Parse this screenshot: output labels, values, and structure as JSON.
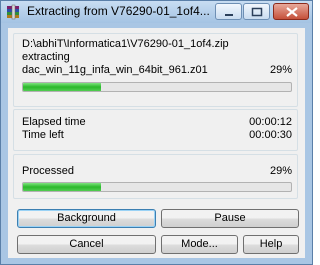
{
  "window": {
    "title": "Extracting from V76290-01_1of4....",
    "icons": {
      "app": "archive-app-icon",
      "minimize": "minimize-icon",
      "maximize": "maximize-icon",
      "close": "close-icon"
    }
  },
  "archive": {
    "path": "D:\\abhiT\\Informatica1\\V76290-01_1of4.zip",
    "action": "extracting",
    "current_file": "dac_win_11g_infa_win_64bit_961.z01",
    "file_percent_text": "29%",
    "file_progress": 0.29
  },
  "timing": {
    "elapsed_label": "Elapsed time",
    "elapsed_value": "00:00:12",
    "left_label": "Time left",
    "left_value": "00:00:30"
  },
  "processed": {
    "label": "Processed",
    "percent_text": "29%",
    "progress": 0.29
  },
  "buttons": {
    "background": "Background",
    "pause": "Pause",
    "cancel": "Cancel",
    "mode": "Mode...",
    "help": "Help"
  }
}
